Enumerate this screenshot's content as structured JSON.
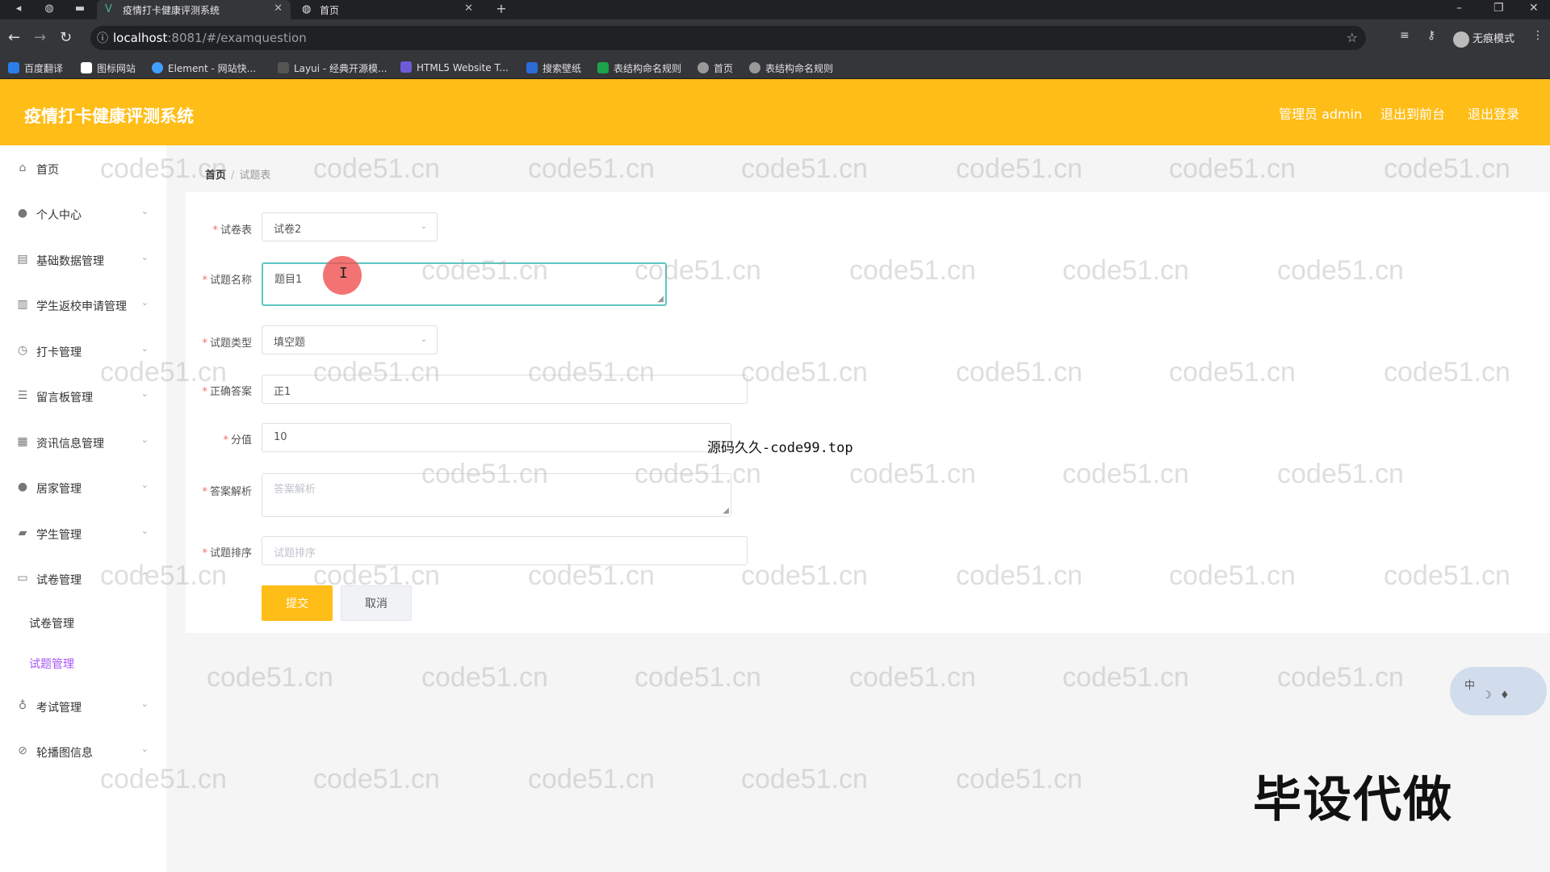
{
  "browser": {
    "tabs": [
      {
        "title": "疫情打卡健康评测系统",
        "active": true,
        "favicon": "vue-icon"
      },
      {
        "title": "首页",
        "active": false,
        "favicon": "globe-icon"
      }
    ],
    "url_host": "localhost",
    "url_path": ":8081/#/examquestion",
    "incognito_label": "无痕模式",
    "bookmarks": [
      {
        "label": "百度翻译"
      },
      {
        "label": "图标网站"
      },
      {
        "label": "Element - 网站快..."
      },
      {
        "label": "Layui - 经典开源模..."
      },
      {
        "label": "HTML5 Website T..."
      },
      {
        "label": "搜索壁纸"
      },
      {
        "label": "表结构命名规则"
      },
      {
        "label": "首页"
      },
      {
        "label": "表结构命名规则"
      }
    ]
  },
  "header": {
    "title": "疫情打卡健康评测系统",
    "admin_label": "管理员 admin",
    "back_label": "退出到前台",
    "logout_label": "退出登录",
    "accent_color": "#ffbd17"
  },
  "sidebar": {
    "items": [
      {
        "label": "首页",
        "icon": "home-icon"
      },
      {
        "label": "个人中心",
        "icon": "user-icon"
      },
      {
        "label": "基础数据管理",
        "icon": "table-icon"
      },
      {
        "label": "学生返校申请管理",
        "icon": "bar-chart-icon"
      },
      {
        "label": "打卡管理",
        "icon": "clock-icon"
      },
      {
        "label": "留言板管理",
        "icon": "sliders-icon"
      },
      {
        "label": "资讯信息管理",
        "icon": "news-icon"
      },
      {
        "label": "居家管理",
        "icon": "person-icon"
      },
      {
        "label": "学生管理",
        "icon": "briefcase-icon"
      },
      {
        "label": "试卷管理",
        "icon": "paper-icon"
      },
      {
        "label": "考试管理",
        "icon": "mic-icon"
      },
      {
        "label": "轮播图信息",
        "icon": "image-icon"
      }
    ],
    "sub_items": [
      {
        "label": "试卷管理",
        "active": false
      },
      {
        "label": "试题管理",
        "active": true
      }
    ]
  },
  "breadcrumb": {
    "home": "首页",
    "current": "试题表"
  },
  "form": {
    "paper": {
      "label": "试卷表",
      "value": "试卷2"
    },
    "name": {
      "label": "试题名称",
      "value": "题目1"
    },
    "type": {
      "label": "试题类型",
      "value": "填空题"
    },
    "answer": {
      "label": "正确答案",
      "value": "正1"
    },
    "score": {
      "label": "分值",
      "value": "10"
    },
    "analysis": {
      "label": "答案解析",
      "placeholder": "答案解析"
    },
    "order": {
      "label": "试题排序",
      "placeholder": "试题排序"
    },
    "submit_label": "提交",
    "cancel_label": "取消"
  },
  "overlay": {
    "source_text": "源码久久-code99.top",
    "stamp_text": "毕设代做",
    "watermark_text": "code51.cn",
    "ime_label": "中"
  }
}
